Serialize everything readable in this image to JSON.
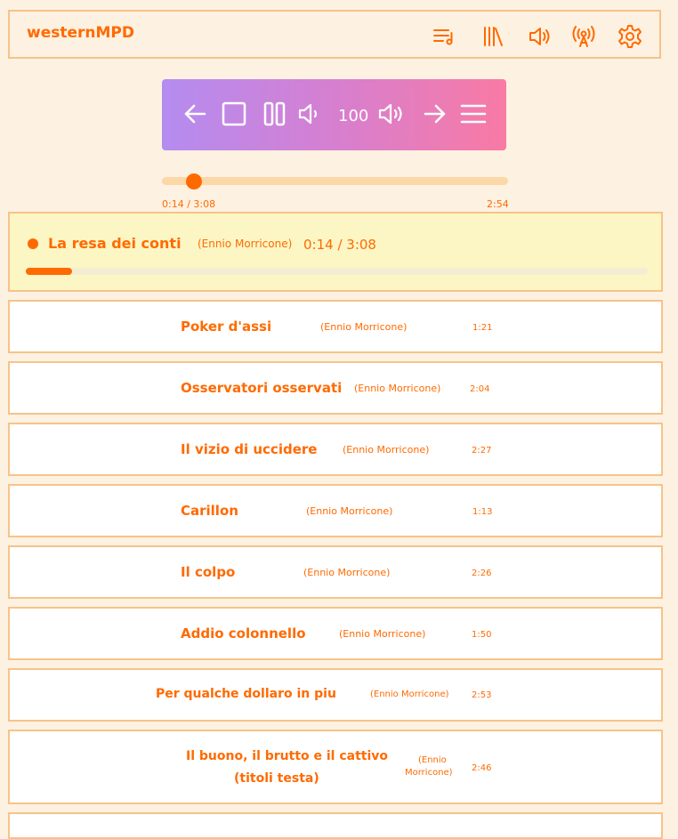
{
  "app": {
    "title": "westernMPD"
  },
  "header_icons": [
    "queue-icon",
    "library-icon",
    "volume-icon",
    "radio-icon",
    "settings-icon"
  ],
  "controls": {
    "volume": "100"
  },
  "progress": {
    "elapsed": "0:14 / 3:08",
    "remaining": "2:54",
    "fraction": 0.074
  },
  "current": {
    "title": "La resa dei conti",
    "artist": "(Ennio Morricone)",
    "time": "0:14 / 3:08"
  },
  "tracks": [
    {
      "title": "Poker d'assi",
      "artist": "(Ennio Morricone)",
      "duration": "1:21"
    },
    {
      "title": "Osservatori osservati",
      "artist": "(Ennio Morricone)",
      "duration": "2:04"
    },
    {
      "title": "Il vizio di uccidere",
      "artist": "(Ennio Morricone)",
      "duration": "2:27"
    },
    {
      "title": "Carillon",
      "artist": "(Ennio Morricone)",
      "duration": "1:13"
    },
    {
      "title": "Il colpo",
      "artist": "(Ennio Morricone)",
      "duration": "2:26"
    },
    {
      "title": "Addio colonnello",
      "artist": "(Ennio Morricone)",
      "duration": "1:50"
    },
    {
      "title": "Per qualche dollaro in piu",
      "artist": "(Ennio Morricone)",
      "duration": "2:53"
    },
    {
      "title_line1": "Il buono, il brutto e il cattivo",
      "title_line2": "(titoli testa)",
      "artist_line1": "(Ennio",
      "artist_line2": "Morricone)",
      "duration": "2:46"
    }
  ],
  "colors": {
    "accent": "#ff6a00",
    "border": "#f6c38a",
    "background": "#fdf1e1",
    "current_bg": "#fbf6c4"
  }
}
